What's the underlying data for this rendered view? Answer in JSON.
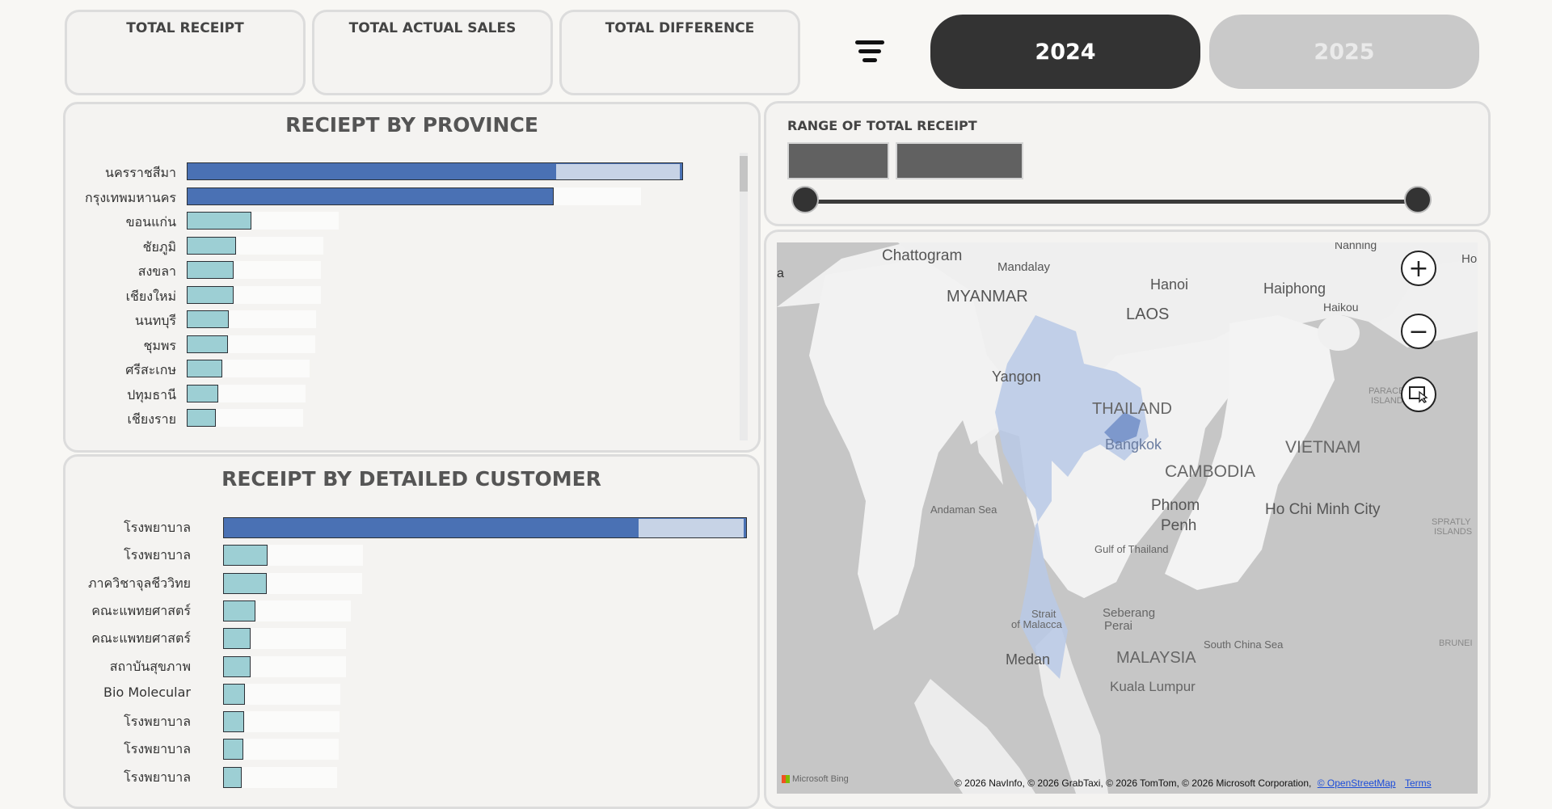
{
  "kpis": [
    {
      "title": "TOTAL RECEIPT"
    },
    {
      "title": "TOTAL ACTUAL SALES"
    },
    {
      "title": "TOTAL DIFFERENCE"
    }
  ],
  "years": {
    "active": "2024",
    "inactive": "2025"
  },
  "colors": {
    "bar_primary": "#4a71b4",
    "bar_secondary": "#9dcfd4",
    "bar_ghost": "#c7d3e6",
    "active_year_bg": "#333333",
    "inactive_year_bg": "#c9c9c9"
  },
  "province": {
    "title": "RECIEPT BY PROVINCE",
    "items": [
      {
        "label": "นครราชสีมา",
        "value": 1.0,
        "ghost": 0.25
      },
      {
        "label": "กรุงเทพมหานคร",
        "value": 0.74
      },
      {
        "label": "ขอนแก่น",
        "value": 0.13
      },
      {
        "label": "ชัยภูมิ",
        "value": 0.1
      },
      {
        "label": "สงขลา",
        "value": 0.095
      },
      {
        "label": "เชียงใหม่",
        "value": 0.094
      },
      {
        "label": "นนทบุรี",
        "value": 0.085
      },
      {
        "label": "ชุมพร",
        "value": 0.083
      },
      {
        "label": "ศรีสะเกษ",
        "value": 0.072
      },
      {
        "label": "ปทุมธานี",
        "value": 0.063
      },
      {
        "label": "เชียงราย",
        "value": 0.058
      }
    ]
  },
  "customer": {
    "title": "RECEIPT BY DETAILED CUSTOMER",
    "items": [
      {
        "label": "โรงพยาบาล",
        "value": 1.0,
        "ghost": 0.2
      },
      {
        "label": "โรงพยาบาล",
        "value": 0.085
      },
      {
        "label": "ภาควิชาจุลชีววิทย",
        "value": 0.084
      },
      {
        "label": "คณะแพทยศาสตร์",
        "value": 0.062
      },
      {
        "label": "คณะแพทยศาสตร์",
        "value": 0.053
      },
      {
        "label": "สถาบันสุขภาพ",
        "value": 0.052
      },
      {
        "label": "Bio Molecular",
        "value": 0.042
      },
      {
        "label": "โรงพยาบาล",
        "value": 0.04
      },
      {
        "label": "โรงพยาบาล",
        "value": 0.038
      },
      {
        "label": "โรงพยาบาล",
        "value": 0.036
      }
    ]
  },
  "range": {
    "title": "RANGE OF TOTAL RECEIPT",
    "min_fraction": 0.0,
    "max_fraction": 1.0
  },
  "map": {
    "labels": [
      "a",
      "Chattogram",
      "Mandalay",
      "Nanning",
      "Hoi",
      "MYANMAR",
      "Hanoi",
      "Haiphong",
      "LAOS",
      "Haikou",
      "Yangon",
      "PARACEL",
      "ISLANDS",
      "THAILAND",
      "Bangkok",
      "VIETNAM",
      "CAMBODIA",
      "Andaman Sea",
      "Phnom",
      "Penh",
      "Ho Chi Minh City",
      "SPRATLY",
      "ISLANDS",
      "Gulf of Thailand",
      "Strait",
      "of Malacca",
      "Seberang",
      "Perai",
      "South China Sea",
      "BRUNEI",
      "Medan",
      "MALAYSIA",
      "Kuala Lumpur"
    ],
    "brand": "Microsoft Bing",
    "copyright": "© 2026 NavInfo, © 2026 GrabTaxi, © 2026 TomTom, © 2026 Microsoft Corporation,",
    "osm_link": "© OpenStreetMap",
    "terms": "Terms",
    "controls": [
      "zoom-in-icon",
      "zoom-out-icon",
      "select-area-icon"
    ]
  }
}
